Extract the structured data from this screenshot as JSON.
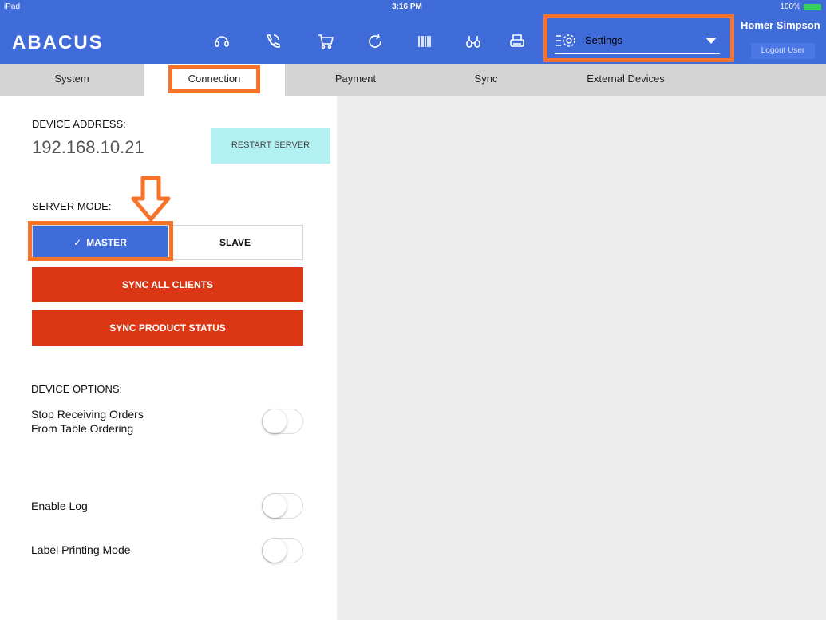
{
  "status": {
    "carrier": "iPad",
    "time": "3:16 PM",
    "battery": "100%"
  },
  "brand": "ABACUS",
  "toolbar": {
    "icons": [
      "headset-icon",
      "phone-icon",
      "cart-icon",
      "refresh-icon",
      "barcode-icon",
      "binoculars-icon",
      "printer-icon"
    ]
  },
  "settings": {
    "label": "Settings"
  },
  "user": {
    "name": "Homer Simpson",
    "logout": "Logout User"
  },
  "tabs": [
    {
      "label": "System"
    },
    {
      "label": "Connection"
    },
    {
      "label": "Payment"
    },
    {
      "label": "Sync"
    },
    {
      "label": "External Devices"
    }
  ],
  "device_address": {
    "label": "DEVICE ADDRESS:",
    "value": "192.168.10.21"
  },
  "restart_label": "RESTART SERVER",
  "server_mode": {
    "label": "SERVER MODE:",
    "master": "MASTER",
    "slave": "SLAVE",
    "check": "✓"
  },
  "sync_all_label": "SYNC ALL CLIENTS",
  "sync_product_label": "SYNC PRODUCT STATUS",
  "device_options": {
    "label": "DEVICE OPTIONS:",
    "stop_orders_line1": "Stop Receiving Orders",
    "stop_orders_line2": "From Table Ordering",
    "enable_log": "Enable Log",
    "label_printing": "Label Printing Mode"
  },
  "colors": {
    "accent": "#3f6cd9",
    "highlight": "#f7732a",
    "danger": "#dc3714",
    "restart_bg": "#b3f0f1"
  }
}
